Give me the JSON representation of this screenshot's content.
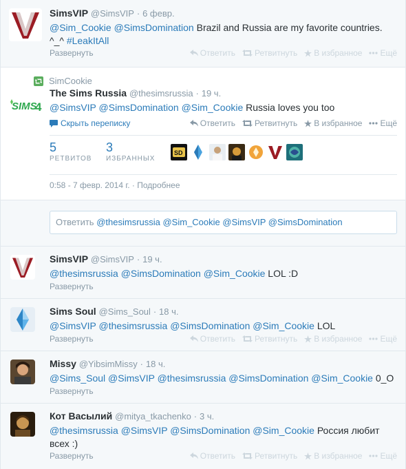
{
  "colors": {
    "link": "#2b7bb9",
    "muted": "#8899a6",
    "faint": "#ccd6dd",
    "text": "#292f33"
  },
  "actions": {
    "reply": "Ответить",
    "retweet": "Ретвитнуть",
    "favorite": "В избранное",
    "more": "Ещё"
  },
  "expand_label": "Развернуть",
  "tweets": {
    "t1": {
      "fullname": "SimsVIP",
      "username": "@SimsVIP",
      "sep": "·",
      "time": "6 февр.",
      "text_parts": [
        "@Sim_Cookie",
        " ",
        "@SimsDomination",
        " Brazil and Russia are my favorite countries. ^_^ ",
        "#LeakItAll"
      ]
    },
    "main": {
      "retweeter": "SimCookie",
      "fullname": "The Sims Russia",
      "username": "@thesimsrussia",
      "sep": "·",
      "time": "19 ч.",
      "text_parts": [
        "@SimsVIP",
        " ",
        "@SimsDomination",
        " ",
        "@Sim_Cookie",
        " Russia loves you too"
      ],
      "hide_conversation": "Скрыть переписку",
      "retweets_count": "5",
      "retweets_label": "РЕТВИТОВ",
      "favorites_count": "3",
      "favorites_label": "ИЗБРАННЫХ",
      "datetime": "0:58 - 7 февр. 2014 г.",
      "details_sep": "·",
      "details": "Подробнее",
      "reply_prefix": "Ответить",
      "reply_mentions": "@thesimsrussia @Sim_Cookie @SimsVIP @SimsDomination"
    },
    "t3": {
      "fullname": "SimsVIP",
      "username": "@SimsVIP",
      "sep": "·",
      "time": "19 ч.",
      "text_parts": [
        "@thesimsrussia",
        " ",
        "@SimsDomination",
        " ",
        "@Sim_Cookie",
        " LOL :D"
      ]
    },
    "t4": {
      "fullname": "Sims Soul",
      "username": "@Sims_Soul",
      "sep": "·",
      "time": "18 ч.",
      "text_parts": [
        "@SimsVIP",
        " ",
        "@thesimsrussia",
        " ",
        "@SimsDomination",
        " ",
        "@Sim_Cookie",
        " LOL"
      ]
    },
    "t5": {
      "fullname": "Missy",
      "username": "@YibsimMissy",
      "sep": "·",
      "time": "18 ч.",
      "text_parts": [
        "@Sims_Soul",
        " ",
        "@SimsVIP",
        " ",
        "@thesimsrussia",
        " ",
        "@SimsDomination",
        " ",
        "@Sim_Cookie",
        " 0_O"
      ]
    },
    "t6": {
      "fullname": "Кот Васылий",
      "username": "@mitya_tkachenko",
      "sep": "·",
      "time": "3 ч.",
      "text_parts": [
        "@thesimsrussia",
        " ",
        "@SimsVIP",
        " ",
        "@SimsDomination",
        " ",
        "@Sim_Cookie",
        "  Россия любит всех :)"
      ]
    }
  }
}
